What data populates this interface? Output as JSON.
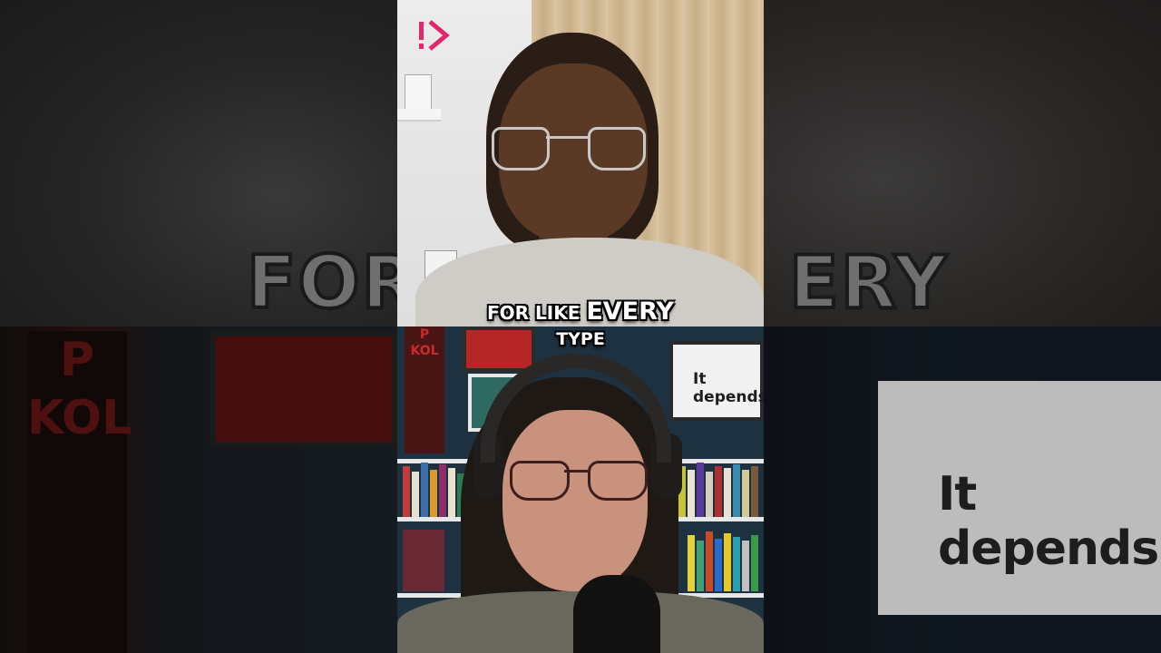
{
  "caption": {
    "line1_prefix": "FOR LIKE",
    "line1_emphasis": "EVERY",
    "line2": "TYPE"
  },
  "background": {
    "ghost_left": "FOR",
    "ghost_right": "ERY"
  },
  "scene": {
    "board_text": "It depends.",
    "banner_text": "P KOL",
    "logo_icon": "brand-logo-icon",
    "accent_color": "#e0276f"
  }
}
